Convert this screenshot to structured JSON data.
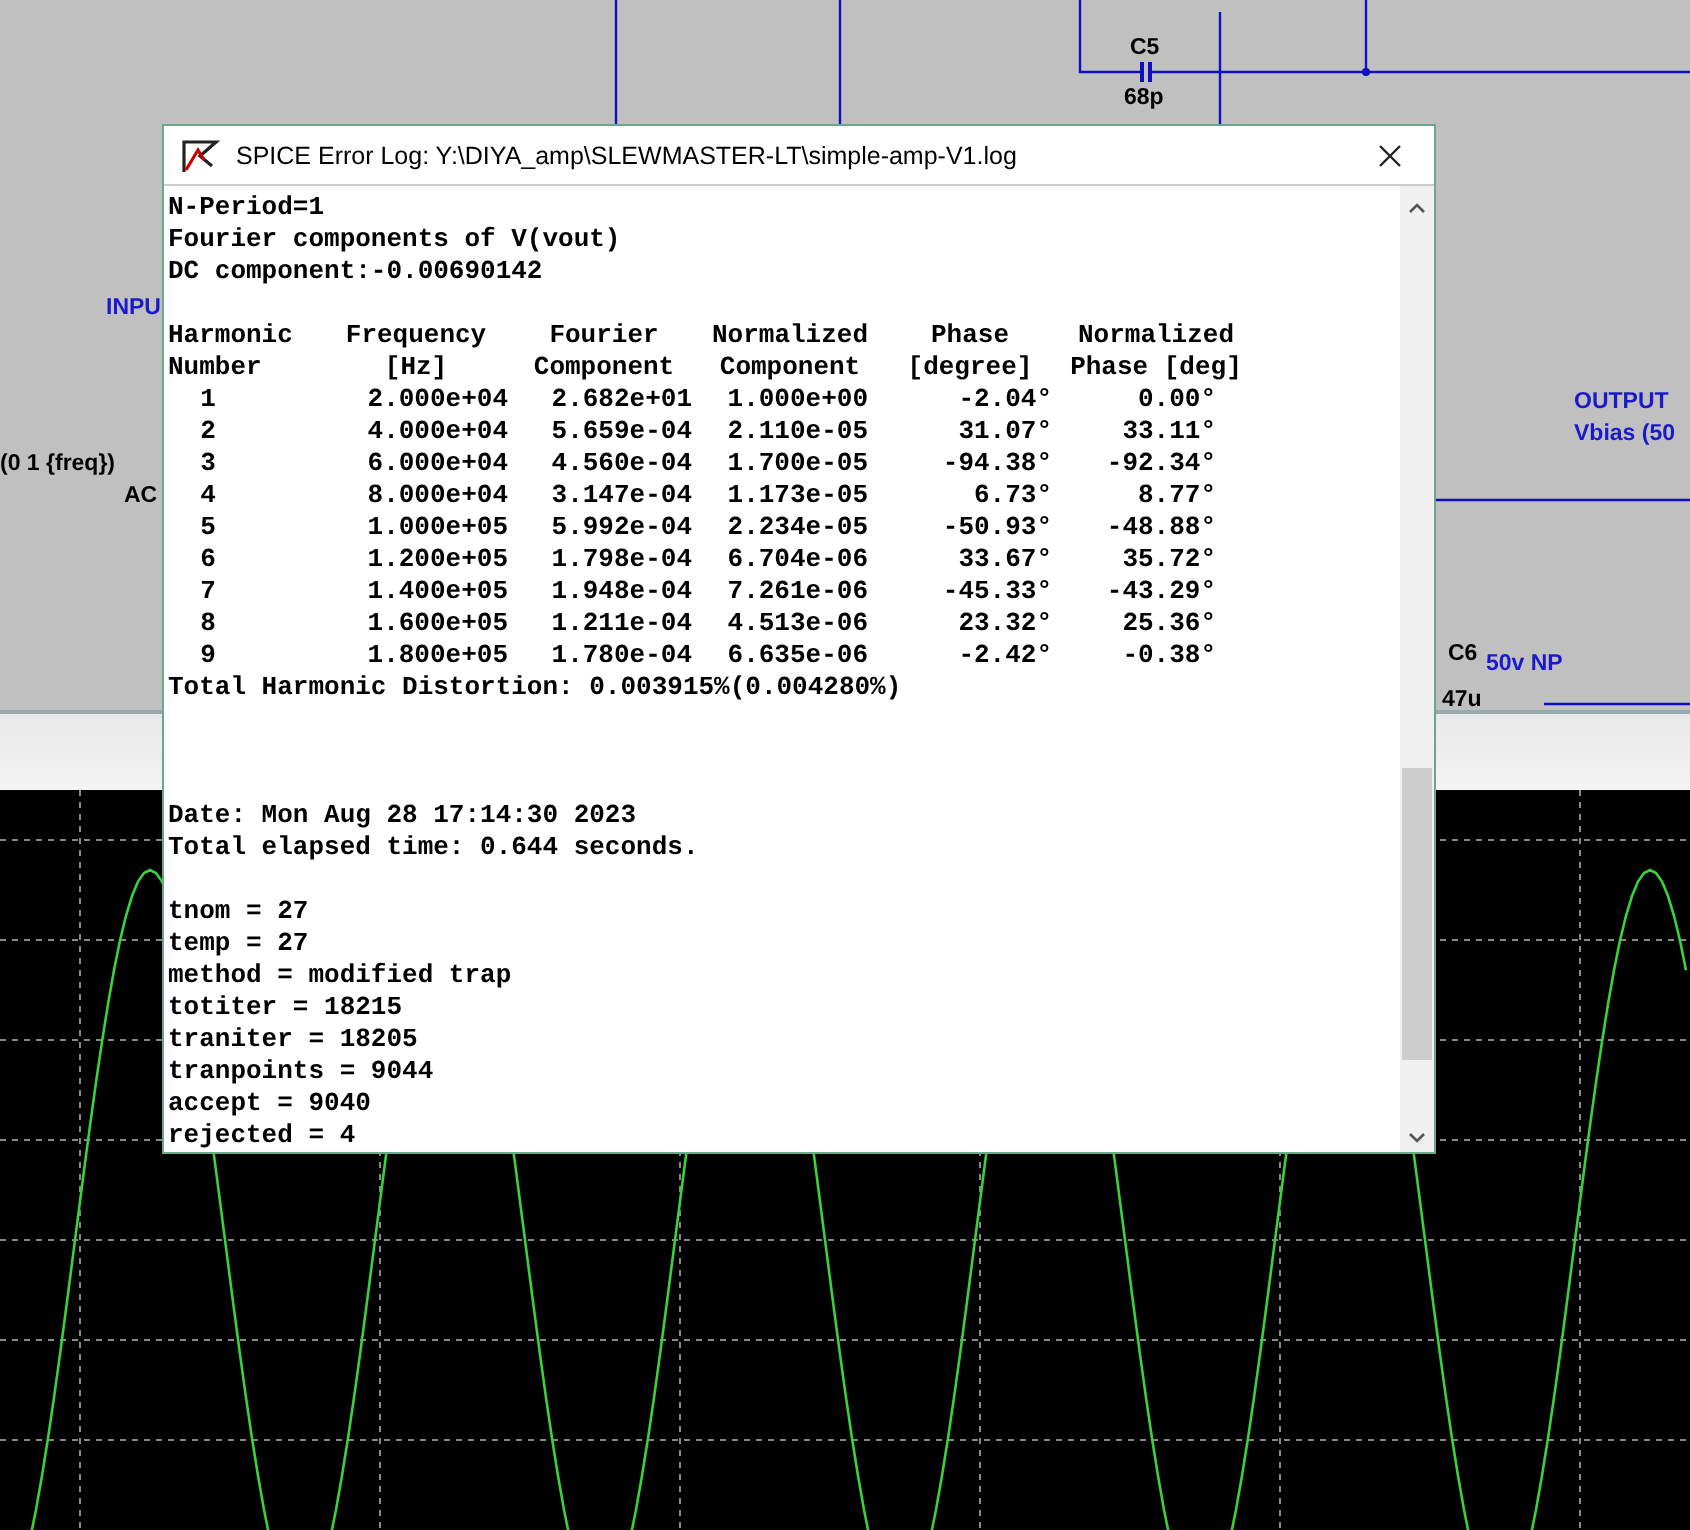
{
  "schematic": {
    "labels": [
      {
        "kind": "part",
        "text": "C5"
      },
      {
        "kind": "value",
        "text": "68p"
      },
      {
        "kind": "net",
        "text": "INPU"
      },
      {
        "kind": "source",
        "text": "(0 1 {freq})"
      },
      {
        "kind": "source",
        "text": "AC"
      },
      {
        "kind": "net",
        "text": "OUTPUT"
      },
      {
        "kind": "net",
        "text": "Vbias (50"
      },
      {
        "kind": "part",
        "text": "C6"
      },
      {
        "kind": "net",
        "text": "50v NP"
      },
      {
        "kind": "value",
        "text": "47u"
      }
    ]
  },
  "window": {
    "title": "SPICE Error Log: Y:\\DIYA_amp\\SLEWMASTER-LT\\simple-amp-V1.log",
    "intro": [
      "N-Period=1",
      "Fourier components of V(vout)",
      "DC component:-0.00690142"
    ],
    "table": {
      "header": [
        [
          "Harmonic",
          "Frequency",
          "Fourier",
          "Normalized",
          "Phase",
          "Normalized"
        ],
        [
          "Number",
          "[Hz]",
          "Component",
          "Component",
          "[degree]",
          "Phase [deg]"
        ]
      ],
      "rows": [
        [
          "1",
          "2.000e+04",
          "2.682e+01",
          "1.000e+00",
          "-2.04°",
          "0.00°"
        ],
        [
          "2",
          "4.000e+04",
          "5.659e-04",
          "2.110e-05",
          "31.07°",
          "33.11°"
        ],
        [
          "3",
          "6.000e+04",
          "4.560e-04",
          "1.700e-05",
          "-94.38°",
          "-92.34°"
        ],
        [
          "4",
          "8.000e+04",
          "3.147e-04",
          "1.173e-05",
          "6.73°",
          "8.77°"
        ],
        [
          "5",
          "1.000e+05",
          "5.992e-04",
          "2.234e-05",
          "-50.93°",
          "-48.88°"
        ],
        [
          "6",
          "1.200e+05",
          "1.798e-04",
          "6.704e-06",
          "33.67°",
          "35.72°"
        ],
        [
          "7",
          "1.400e+05",
          "1.948e-04",
          "7.261e-06",
          "-45.33°",
          "-43.29°"
        ],
        [
          "8",
          "1.600e+05",
          "1.211e-04",
          "4.513e-06",
          "23.32°",
          "25.36°"
        ],
        [
          "9",
          "1.800e+05",
          "1.780e-04",
          "6.635e-06",
          "-2.42°",
          "-0.38°"
        ]
      ]
    },
    "thd": "Total Harmonic Distortion: 0.003915%(0.004280%)",
    "run_info": [
      "Date: Mon Aug 28 17:14:30 2023",
      "Total elapsed time: 0.644 seconds."
    ],
    "stats": [
      "tnom = 27",
      "temp = 27",
      "method = modified trap",
      "totiter = 18215",
      "traniter = 18205",
      "tranpoints = 9044",
      "accept = 9040",
      "rejected = 4"
    ]
  }
}
